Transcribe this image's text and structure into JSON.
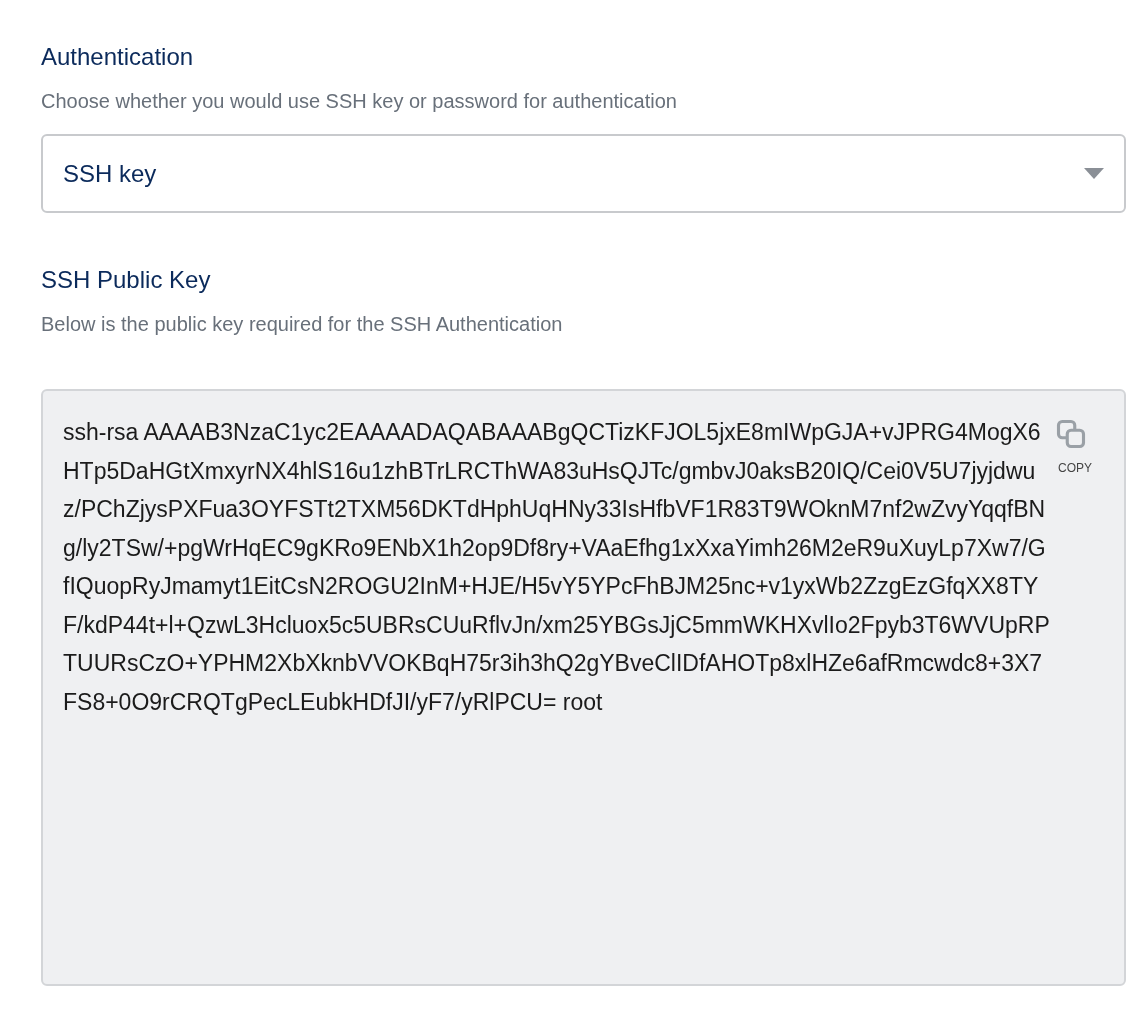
{
  "authentication": {
    "title": "Authentication",
    "description": "Choose whether you would use SSH key or password for authentication",
    "select": {
      "value": "SSH key"
    }
  },
  "public_key": {
    "title": "SSH Public Key",
    "description": "Below is the public key required for the SSH Authentication",
    "key": "ssh-rsa AAAAB3NzaC1yc2EAAAADAQABAAABgQCTizKFJOL5jxE8mIWpGJA+vJPRG4MogX6HTp5DaHGtXmxyrNX4hlS16u1zhBTrLRCThWA83uHsQJTc/gmbvJ0aksB20IQ/Cei0V5U7jyjdwuz/PChZjysPXFua3OYFSTt2TXM56DKTdHphUqHNy33IsHfbVF1R83T9WOknM7nf2wZvyYqqfBNg/ly2TSw/+pgWrHqEC9gKRo9ENbX1h2op9Df8ry+VAaEfhg1xXxaYimh26M2eR9uXuyLp7Xw7/GfIQuopRyJmamyt1EitCsN2ROGU2InM+HJE/H5vY5YPcFhBJM25nc+v1yxWb2ZzgEzGfqXX8TYF/kdP44t+l+QzwL3Hcluox5c5UBRsCUuRflvJn/xm25YBGsJjC5mmWKHXvlIo2Fpyb3T6WVUpRPTUURsCzO+YPHM2XbXknbVVOKBqH75r3ih3hQ2gYBveClIDfAHOTp8xlHZe6afRmcwdc8+3X7FS8+0O9rCRQTgPecLEubkHDfJI/yF7/yRlPCU= root",
    "copy_label": "COPY"
  }
}
